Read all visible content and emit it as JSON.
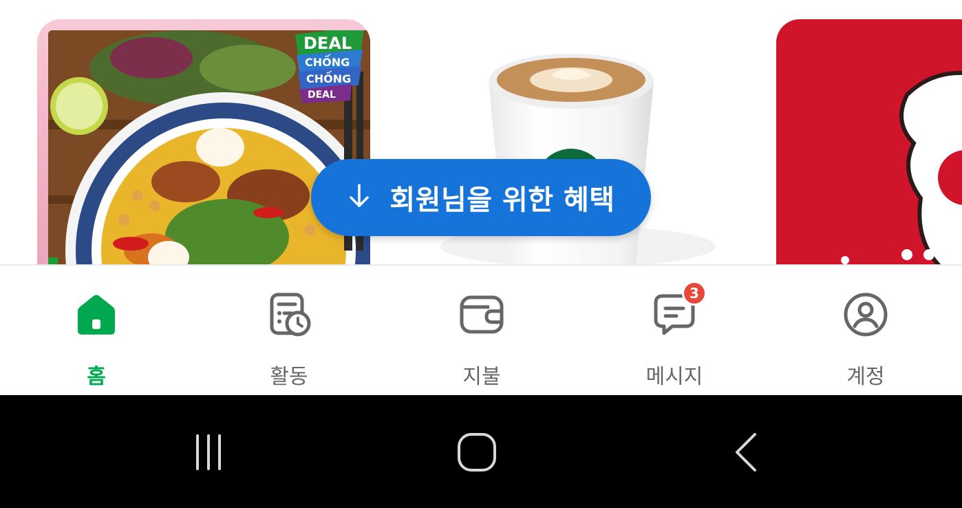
{
  "promo_pill": {
    "arrow": "↓",
    "label": "회원님을 위한 혜택"
  },
  "carousel": {
    "cards": [
      {
        "name": "food-deal",
        "badge_lines": [
          "DEAL",
          "CHỐNG",
          "CHỐNG",
          "DEAL"
        ]
      },
      {
        "name": "coffee"
      },
      {
        "name": "red-brand"
      }
    ]
  },
  "bottom_nav": {
    "items": [
      {
        "label": "홈",
        "icon": "home-icon",
        "active": true
      },
      {
        "label": "활동",
        "icon": "activity-icon"
      },
      {
        "label": "지불",
        "icon": "wallet-icon"
      },
      {
        "label": "메시지",
        "icon": "message-icon",
        "badge": "3"
      },
      {
        "label": "계정",
        "icon": "account-icon"
      }
    ]
  },
  "colors": {
    "accent_green": "#00a94f",
    "pill_blue": "#1673d9",
    "badge_red": "#e8473a",
    "inactive_gray": "#666666"
  }
}
